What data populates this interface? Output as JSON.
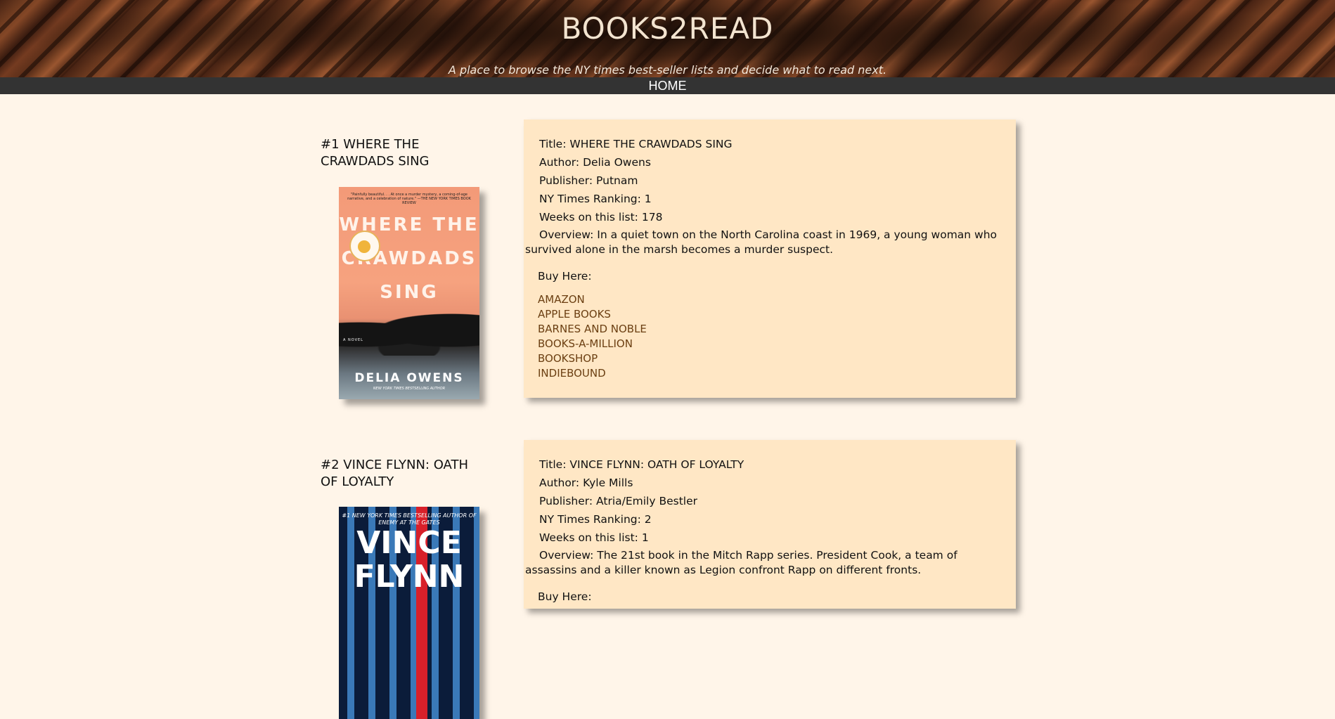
{
  "site": {
    "title": "BOOKS2READ",
    "tagline": "A place to browse the NY times best-seller lists and decide what to read next.",
    "nav": [
      "HOME"
    ]
  },
  "books": [
    {
      "heading": "#1 WHERE THE CRAWDADS SING",
      "title_label": "Title:",
      "title": "WHERE THE CRAWDADS SING",
      "author_label": "Author:",
      "author": "Delia Owens",
      "publisher_label": "Publisher:",
      "publisher": "Putnam",
      "ranking_label": "NY Times Ranking:",
      "ranking": "1",
      "weeks_label": "Weeks on this list:",
      "weeks": "178",
      "overview_label": "Overview:",
      "overview": "In a quiet town on the North Carolina coast in 1969, a young woman who survived alone in the marsh becomes a murder suspect.",
      "buy_label": "Buy Here:",
      "buy_links": [
        "AMAZON",
        "APPLE BOOKS",
        "BARNES AND NOBLE",
        "BOOKS-A-MILLION",
        "BOOKSHOP",
        "INDIEBOUND"
      ],
      "cover": {
        "quote": "\"Painfully beautiful. . . At once a murder mystery, a coming-of-age narrative, and a celebration of nature.\" —THE NEW YORK TIMES BOOK REVIEW",
        "title": "WHERE THE CRAWDADS SING",
        "novel": "A NOVEL",
        "author": "DELIA OWENS",
        "sub": "NEW YORK TIMES BESTSELLING AUTHOR"
      }
    },
    {
      "heading": "#2 VINCE FLYNN: OATH OF LOYALTY",
      "title_label": "Title:",
      "title": "VINCE FLYNN: OATH OF LOYALTY",
      "author_label": "Author:",
      "author": "Kyle Mills",
      "publisher_label": "Publisher:",
      "publisher": "Atria/Emily Bestler",
      "ranking_label": "NY Times Ranking:",
      "ranking": "2",
      "weeks_label": "Weeks on this list:",
      "weeks": "1",
      "overview_label": "Overview:",
      "overview": "The 21st book in the Mitch Rapp series. President Cook, a team of assassins and a killer known as Legion confront Rapp on different fronts.",
      "buy_label": "Buy Here:",
      "cover": {
        "top": "#1 NEW YORK TIMES BESTSELLING AUTHOR OF ENEMY AT THE GATES",
        "title": "VINCE FLYNN"
      }
    }
  ]
}
